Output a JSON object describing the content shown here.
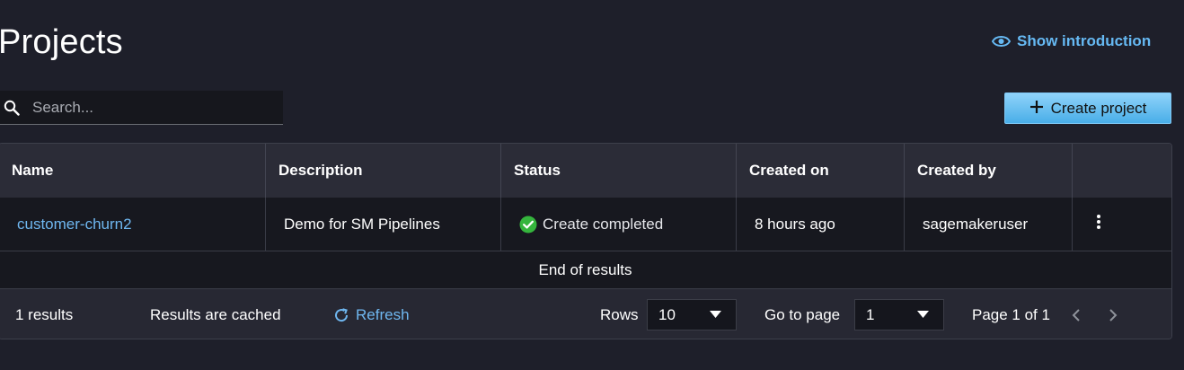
{
  "page": {
    "title": "Projects",
    "show_intro_label": "Show introduction"
  },
  "search": {
    "placeholder": "Search...",
    "value": ""
  },
  "create_button": {
    "label": "Create project"
  },
  "table": {
    "columns": [
      "Name",
      "Description",
      "Status",
      "Created on",
      "Created by",
      ""
    ],
    "rows": [
      {
        "name": "customer-churn2",
        "description": "Demo for SM Pipelines",
        "status": "Create completed",
        "created_on": "8 hours ago",
        "created_by": "sagemakeruser"
      }
    ],
    "end_text": "End of results"
  },
  "footer": {
    "results_count": "1 results",
    "cached_text": "Results are cached",
    "refresh_label": "Refresh",
    "rows_label": "Rows",
    "rows_value": "10",
    "goto_label": "Go to page",
    "goto_value": "1",
    "page_info": "Page 1 of 1"
  },
  "colors": {
    "background": "#1e1f2a",
    "accent": "#6fb7f0",
    "success": "#35b53d",
    "button": "#49aee8"
  },
  "icons": [
    "eye-icon",
    "search-icon",
    "plus-icon",
    "check-circle-icon",
    "kebab-menu-icon",
    "refresh-icon",
    "caret-down-icon",
    "chevron-left-icon",
    "chevron-right-icon"
  ]
}
